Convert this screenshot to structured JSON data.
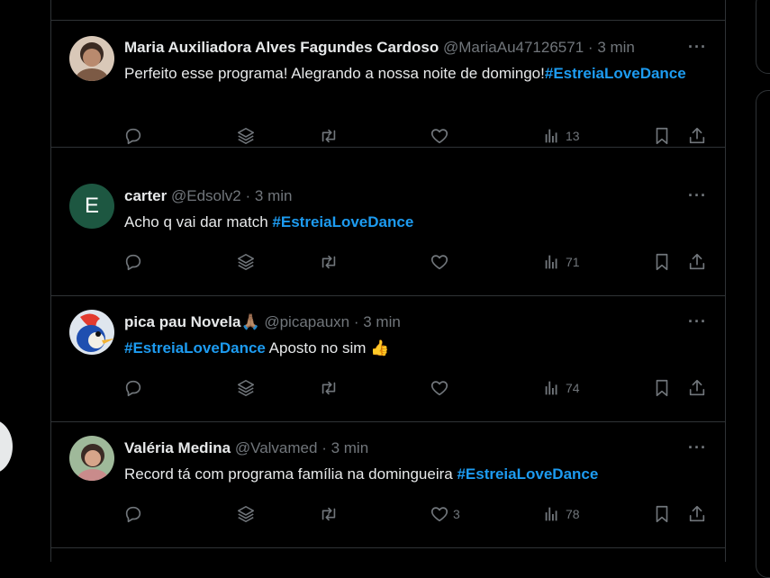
{
  "tweets": [
    {
      "name": "Maria Auxiliadora Alves Fagundes Cardoso",
      "handle": "@MariaAu47126571",
      "time": "3 min",
      "text_before": "Perfeito esse programa! Alegrando a nossa noite de domingo!",
      "hashtag": "#EstreiaLoveDance",
      "text_after": "",
      "likes": "",
      "views": "13",
      "avatar": {
        "type": "photo",
        "icon": "profile-photo-woman",
        "colors": [
          "#7c5a45",
          "#d9c8b8"
        ]
      }
    },
    {
      "name": "carter",
      "handle": "@Edsolv2",
      "time": "3 min",
      "text_before": "Acho q vai dar match ",
      "hashtag": "#EstreiaLoveDance",
      "text_after": "",
      "likes": "",
      "views": "71",
      "avatar": {
        "type": "letter",
        "letter": "E",
        "colors": [
          "#1d5741"
        ]
      }
    },
    {
      "name": "pica pau Novela",
      "name_emoji": "🙏🏽",
      "handle": "@picapauxn",
      "time": "3 min",
      "text_before": "",
      "hashtag": "#EstreiaLoveDance",
      "text_after": " Aposto no sim 👍",
      "likes": "",
      "views": "74",
      "avatar": {
        "type": "photo",
        "icon": "woodpecker-cartoon",
        "colors": [
          "#1f4fb0",
          "#e33b2f"
        ]
      }
    },
    {
      "name": "Valéria Medina",
      "handle": "@Valvamed",
      "time": "3 min",
      "text_before": "Record tá com programa família na domingueira ",
      "hashtag": "#EstreiaLoveDance",
      "text_after": "",
      "likes": "3",
      "views": "78",
      "avatar": {
        "type": "photo",
        "icon": "profile-photo-woman",
        "colors": [
          "#9fb99a",
          "#c98b8b"
        ]
      }
    }
  ],
  "separator": "·",
  "more_glyph": "···",
  "colors": {
    "accent": "#1d9bf0",
    "muted": "#71767b",
    "border": "#2f3336",
    "background": "#000000"
  }
}
